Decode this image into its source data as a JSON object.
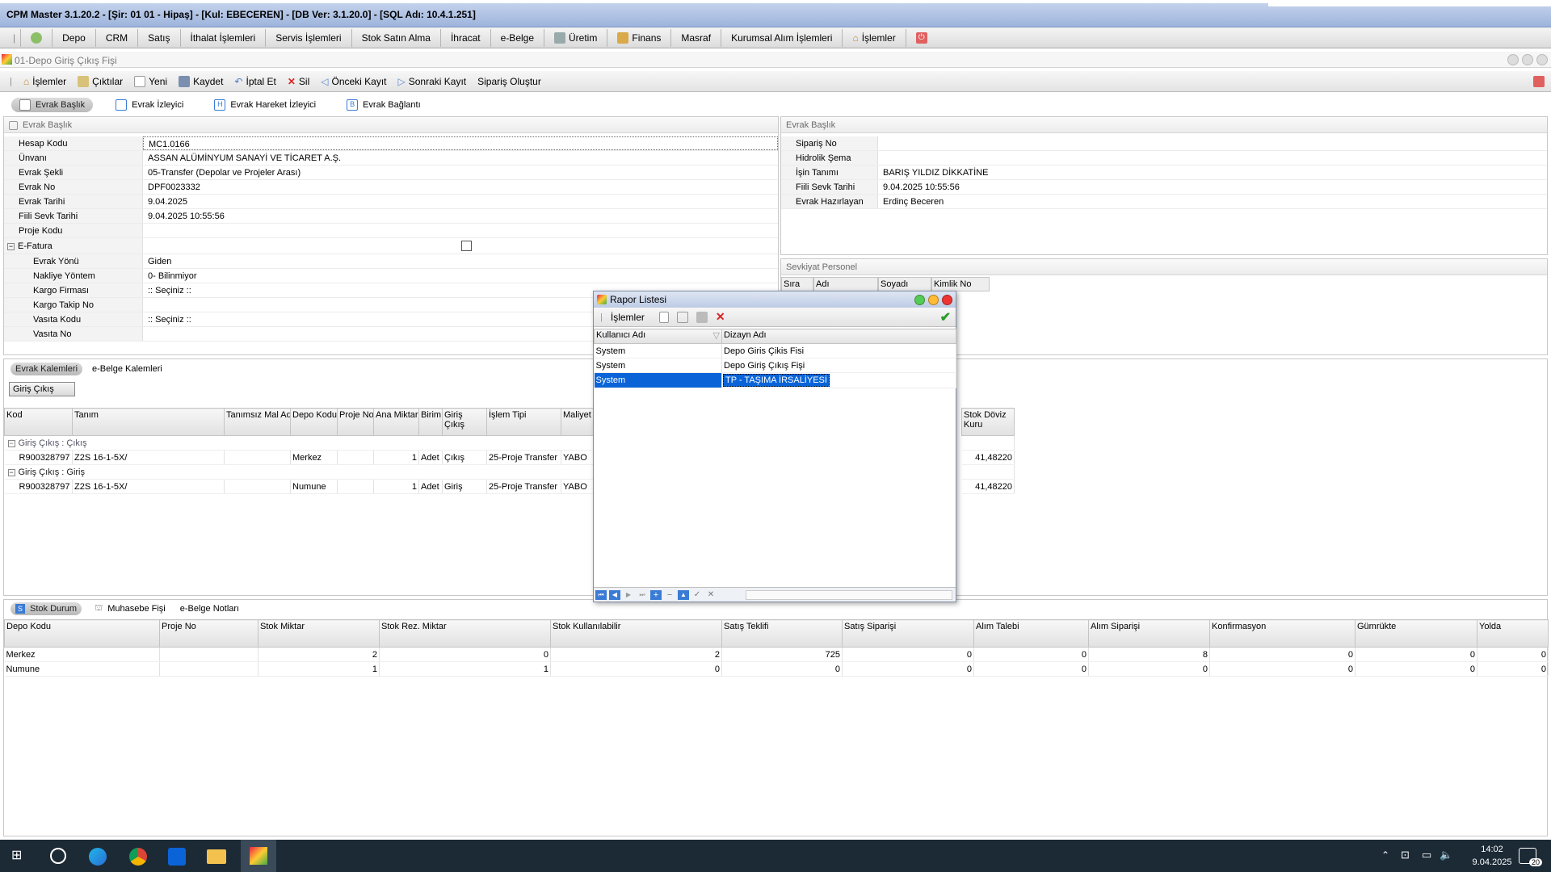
{
  "app": {
    "title": "CPM Master 3.1.20.2 - [Şir: 01 01 - Hipaş] - [Kul: EBECEREN] - [DB Ver: 3.1.20.0] - [SQL Adı: 10.4.1.251]",
    "menu": [
      "Depo",
      "CRM",
      "Satış",
      "İthalat İşlemleri",
      "Servis İşlemleri",
      "Stok Satın Alma",
      "İhracat",
      "e-Belge",
      "Üretim",
      "Finans",
      "Masraf",
      "Kurumsal Alım İşlemleri",
      "İşlemler"
    ]
  },
  "window": {
    "title": "01-Depo Giriş Çıkış Fişi",
    "toolbar": [
      "İşlemler",
      "Çıktılar",
      "Yeni",
      "Kaydet",
      "İptal Et",
      "Sil",
      "Önceki Kayıt",
      "Sonraki Kayıt",
      "Sipariş Oluştur"
    ],
    "tabs": [
      "Evrak Başlık",
      "Evrak İzleyici",
      "Evrak Hareket İzleyici",
      "Evrak Bağlantı"
    ]
  },
  "left_panel": {
    "header": "Evrak Başlık",
    "rows": [
      {
        "k": "Hesap Kodu",
        "v": "MC1.0166"
      },
      {
        "k": "Ünvanı",
        "v": "ASSAN ALÜMİNYUM SANAYİ VE TİCARET A.Ş."
      },
      {
        "k": "Evrak Şekli",
        "v": "05-Transfer (Depolar ve Projeler Arası)"
      },
      {
        "k": "Evrak No",
        "v": "DPF0023332"
      },
      {
        "k": "Evrak Tarihi",
        "v": "9.04.2025"
      },
      {
        "k": "Fiili Sevk Tarihi",
        "v": "9.04.2025 10:55:56"
      },
      {
        "k": "Proje Kodu",
        "v": ""
      }
    ],
    "efatura_label": "E-Fatura",
    "efatura_rows": [
      {
        "k": "Evrak Yönü",
        "v": "Giden"
      },
      {
        "k": "Nakliye Yöntem",
        "v": "0- Bilinmiyor"
      },
      {
        "k": "Kargo Firması",
        "v": ":: Seçiniz ::"
      },
      {
        "k": "Kargo Takip No",
        "v": ""
      },
      {
        "k": "Vasıta Kodu",
        "v": ":: Seçiniz ::"
      },
      {
        "k": "Vasıta No",
        "v": ""
      }
    ]
  },
  "right_panel": {
    "header": "Evrak Başlık",
    "rows": [
      {
        "k": "Sipariş No",
        "v": ""
      },
      {
        "k": "Hidrolik Şema",
        "v": ""
      },
      {
        "k": "İşin Tanımı",
        "v": "BARIŞ YILDIZ DİKKATİNE"
      },
      {
        "k": "Fiili Sevk Tarihi",
        "v": "9.04.2025 10:55:56"
      },
      {
        "k": "Evrak Hazırlayan",
        "v": "Erdinç Beceren"
      }
    ],
    "sevkiyat_header": "Sevkiyat Personel",
    "sevkiyat_cols": [
      "Sıra No",
      "Adı",
      "Soyadı",
      "Kimlik No"
    ]
  },
  "items": {
    "tabs": [
      "Evrak Kalemleri",
      "e-Belge Kalemleri"
    ],
    "group_chip": "Giriş Çıkış",
    "columns": [
      "Kod",
      "Tanım",
      "Tanımsız Mal Adı",
      "Depo Kodu",
      "Proje No",
      "Ana Miktar",
      "Birim",
      "Giriş Çıkış",
      "İşlem Tipi",
      "Maliyet"
    ],
    "right_column": "Stok Döviz Kuru",
    "groups": [
      {
        "label": "Giriş Çıkış : Çıkış",
        "row": [
          "R900328797",
          "Z2S 16-1-5X/",
          "",
          "Merkez",
          "",
          "1",
          "Adet",
          "Çıkış",
          "25-Proje Transfer",
          "YABO"
        ],
        "kur": "41,48220"
      },
      {
        "label": "Giriş Çıkış : Giriş",
        "row": [
          "R900328797",
          "Z2S 16-1-5X/",
          "",
          "Numune",
          "",
          "1",
          "Adet",
          "Giriş",
          "25-Proje Transfer",
          "YABO"
        ],
        "kur": "41,48220"
      }
    ]
  },
  "stock": {
    "tabs": [
      "Stok Durum",
      "Muhasebe Fişi",
      "e-Belge Notları"
    ],
    "columns": [
      "Depo Kodu",
      "Proje No",
      "Stok Miktar",
      "Stok Rez. Miktar",
      "Stok Kullanılabilir",
      "Satış Teklifi",
      "Satış Siparişi",
      "Alım Talebi",
      "Alım Siparişi",
      "Konfirmasyon",
      "Gümrükte",
      "Yolda"
    ],
    "rows": [
      [
        "Merkez",
        "",
        "2",
        "0",
        "2",
        "725",
        "0",
        "0",
        "8",
        "0",
        "0",
        "0"
      ],
      [
        "Numune",
        "",
        "1",
        "1",
        "0",
        "0",
        "0",
        "0",
        "0",
        "0",
        "0",
        "0"
      ]
    ]
  },
  "dialog": {
    "title": "Rapor Listesi",
    "menu_label": "İşlemler",
    "columns": [
      "Kullanıcı Adı",
      "Dizayn Adı"
    ],
    "rows": [
      [
        "System",
        "Depo Giris Çikis Fisi"
      ],
      [
        "System",
        "Depo Giriş Çıkış Fişi"
      ],
      [
        "System",
        "TP - TAŞIMA İRSALİYESİ"
      ]
    ],
    "selected_index": 2
  },
  "taskbar": {
    "time": "14:02",
    "date": "9.04.2025",
    "badge": "20"
  },
  "colors": {
    "title_bg": "#a9bde2",
    "selection": "#0a64d8",
    "taskbar": "#1c2a36"
  }
}
